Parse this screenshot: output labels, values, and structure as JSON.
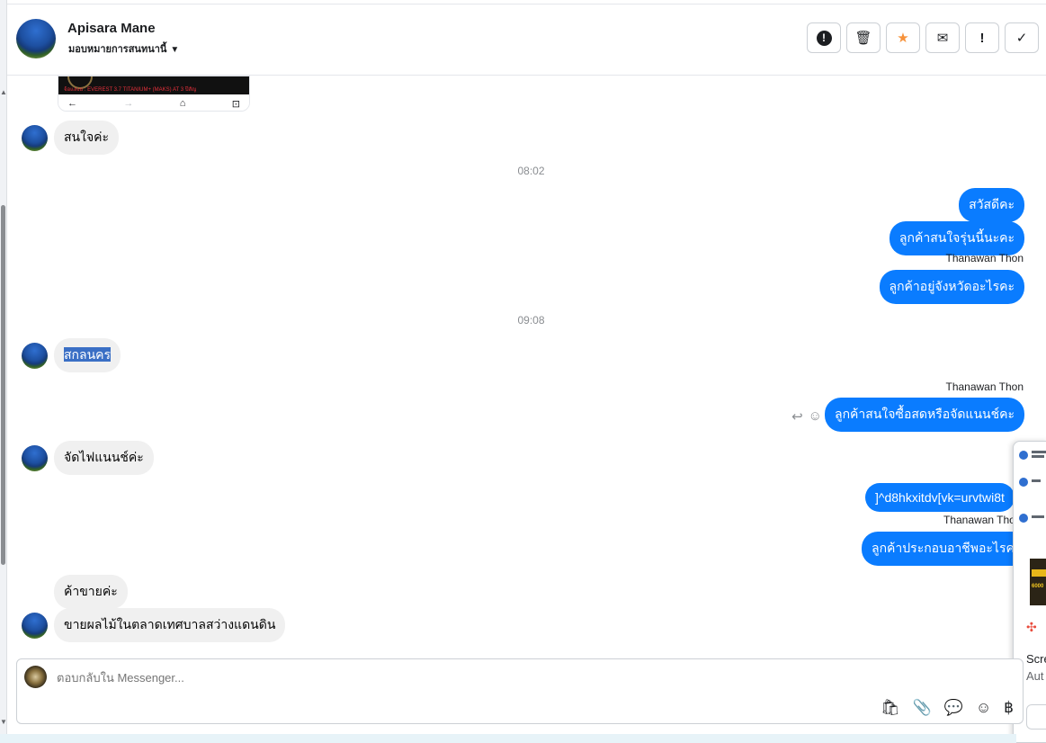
{
  "header": {
    "contact_name": "Apisara Mane",
    "assign_label": "มอบหมายการสนทนานี้",
    "actions": [
      {
        "icon": "alert-circle-icon",
        "glyph": "!"
      },
      {
        "icon": "trash-icon",
        "glyph": "🗑"
      },
      {
        "icon": "star-icon",
        "glyph": "★"
      },
      {
        "icon": "envelope-icon",
        "glyph": "✉"
      },
      {
        "icon": "exclamation-icon",
        "glyph": "!"
      },
      {
        "icon": "check-icon",
        "glyph": "✓"
      }
    ]
  },
  "image_snippet": {
    "caption": "จ้อแลงย : EVEREST 3.7 TITANIUM+ (MAKS) AT 3 ปีสัญ"
  },
  "messages": {
    "m1": "สนใจค่ะ",
    "t1": "08:02",
    "o1": "สวัสดีคะ",
    "o2": "ลูกค้าสนใจรุ่นนี้นะคะ",
    "s1": "Thanawan Thon",
    "o3": "ลูกค้าอยู่จังหวัดอะไรคะ",
    "t2": "09:08",
    "m2": "สกลนคร",
    "s2": "Thanawan Thon",
    "o4": "ลูกค้าสนใจซื้อสดหรือจัดแนนช์คะ",
    "m3": "จัดไฟแนนช์ค่ะ",
    "o5": "]^d8hkxitdv[vk=urvtwi8t",
    "s3": "Thanawan Tho",
    "o6": "ลูกค้าประกอบอาชีพอะไรคะ",
    "m4": "ค้าขายค่ะ",
    "m5": "ขายผลไม้ในตลาดเทศบาลสว่างแดนดิน"
  },
  "side_panel": {
    "thumb_text": "6000",
    "label_1": "Scre",
    "label_2": "Aut"
  },
  "composer": {
    "placeholder": "ตอบกลับใน Messenger...",
    "tools": [
      {
        "icon": "shopping-bag-icon",
        "glyph": "🛍"
      },
      {
        "icon": "paperclip-icon",
        "glyph": "📎"
      },
      {
        "icon": "saved-reply-icon",
        "glyph": "💬"
      },
      {
        "icon": "emoji-icon",
        "glyph": "☺"
      },
      {
        "icon": "baht-icon",
        "glyph": "฿"
      }
    ]
  }
}
